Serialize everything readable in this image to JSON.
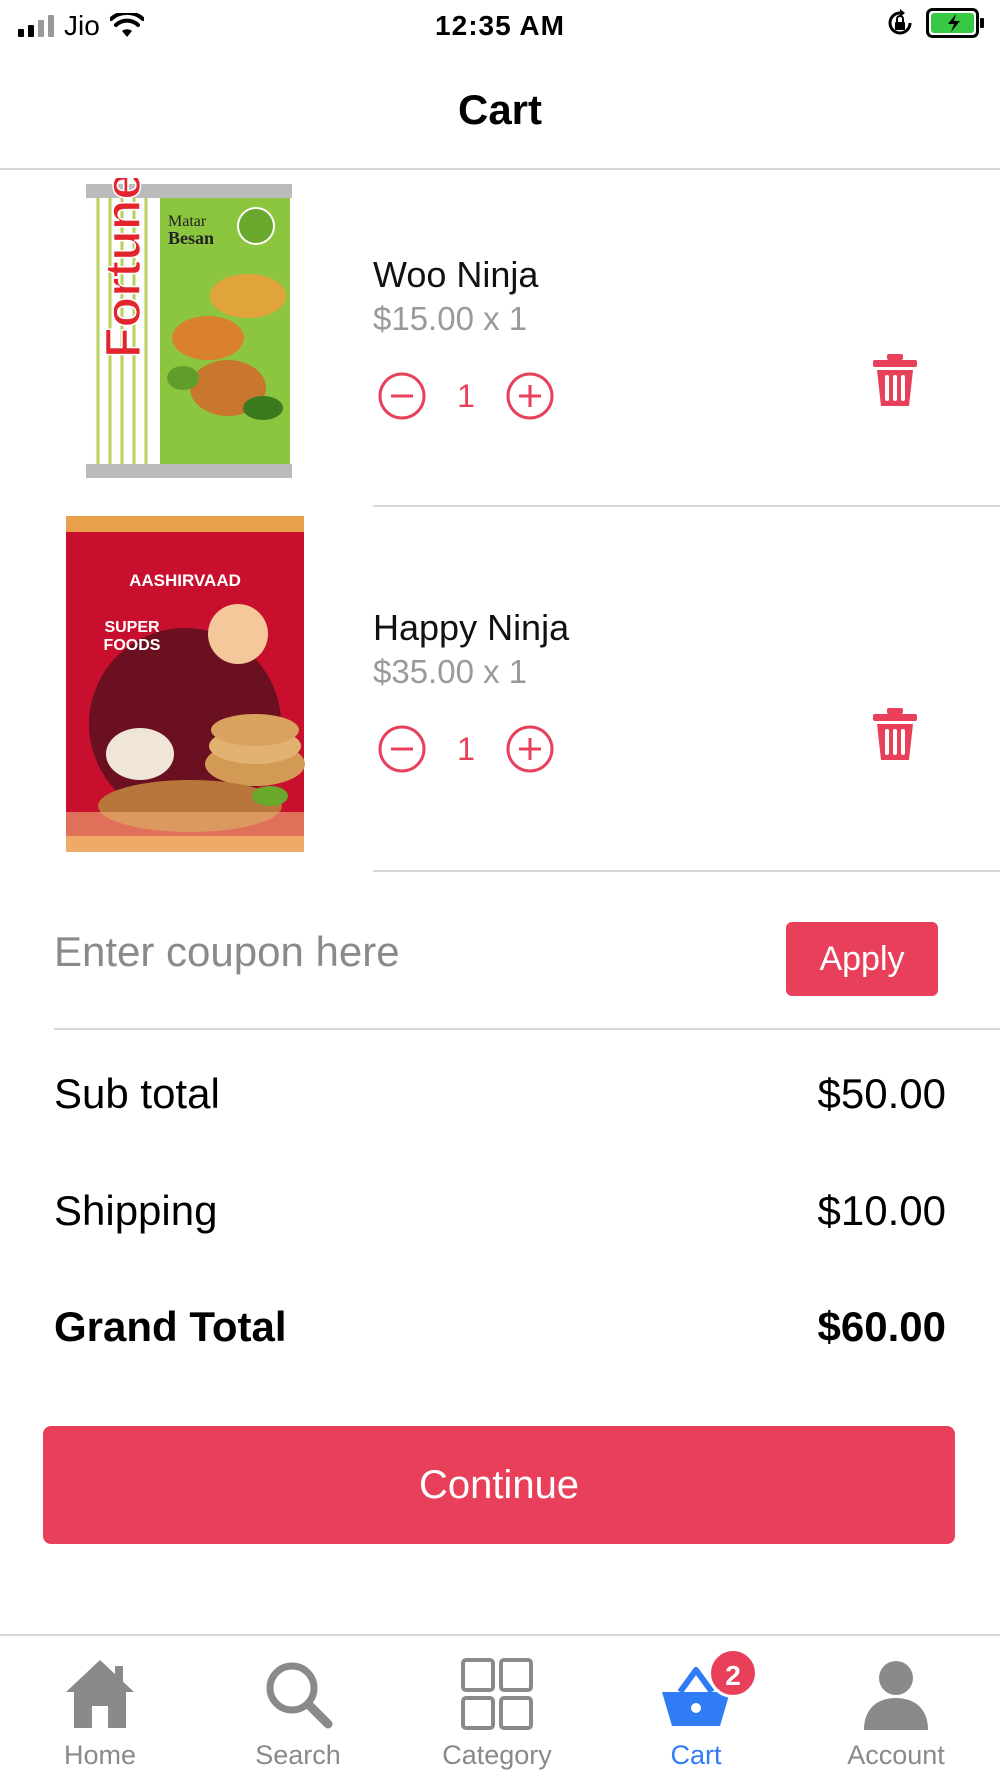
{
  "status_bar": {
    "carrier": "Jio",
    "time": "12:35 AM"
  },
  "nav": {
    "title": "Cart"
  },
  "cart_items": [
    {
      "name": "Woo Ninja",
      "price_line": "$15.00 x 1",
      "quantity": "1",
      "image": "fortune-matar-besan-pack"
    },
    {
      "name": "Happy Ninja",
      "price_line": "$35.00 x 1",
      "quantity": "1",
      "image": "aashirvaad-multi-millet-mix-pack"
    }
  ],
  "coupon": {
    "placeholder": "Enter coupon here",
    "apply_label": "Apply"
  },
  "totals": {
    "sub_total_label": "Sub total",
    "sub_total_value": "$50.00",
    "shipping_label": "Shipping",
    "shipping_value": "$10.00",
    "grand_total_label": "Grand Total",
    "grand_total_value": "$60.00"
  },
  "continue_label": "Continue",
  "tabs": [
    {
      "label": "Home",
      "icon": "home-icon"
    },
    {
      "label": "Search",
      "icon": "search-icon"
    },
    {
      "label": "Category",
      "icon": "grid-icon"
    },
    {
      "label": "Cart",
      "icon": "basket-icon",
      "badge": "2",
      "active": true
    },
    {
      "label": "Account",
      "icon": "person-icon"
    }
  ],
  "colors": {
    "accent": "#e8405a",
    "active_tab": "#2f7cf6",
    "inactive_tab": "#8a8a8a",
    "battery": "#37c943"
  }
}
